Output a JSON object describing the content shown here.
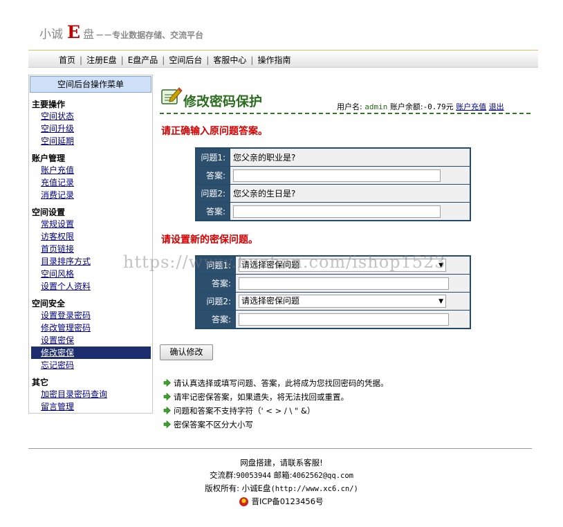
{
  "header": {
    "brand_part1": "小诚",
    "brand_e": "E",
    "brand_part2": "盘",
    "slogan": "－－专业数据存储、交流平台"
  },
  "nav": {
    "items": [
      "首页",
      "注册E盘",
      "E盘产品",
      "空间后台",
      "客服中心",
      "操作指南"
    ],
    "separator": "|"
  },
  "sidebar": {
    "title": "空间后台操作菜单",
    "groups": [
      {
        "title": "主要操作",
        "links": [
          "空间状态",
          "空间升级",
          "空间延期"
        ]
      },
      {
        "title": "账户管理",
        "links": [
          "账户充值",
          "充值记录",
          "消费记录"
        ]
      },
      {
        "title": "空间设置",
        "links": [
          "常规设置",
          "访客权限",
          "首页链接",
          "目录排序方式",
          "空间风格",
          "设置个人资料"
        ]
      },
      {
        "title": "空间安全",
        "links": [
          "设置登录密码",
          "修改管理密码",
          "设置密保",
          "修改密保",
          "忘记密码"
        ]
      },
      {
        "title": "其它",
        "links": [
          "加密目录密码查询",
          "留言管理"
        ]
      }
    ],
    "active_link": "修改密保"
  },
  "main": {
    "title": "修改密码保护",
    "user_label": "用户名:",
    "username": "admin",
    "balance_label": "账户余额:",
    "balance": "-0.79元",
    "recharge_link": "账户充值",
    "logout_link": "退出"
  },
  "old_answers": {
    "heading": "请正确输入原问题答案。",
    "q1_label": "问题1:",
    "q1_text": "您父亲的职业是?",
    "a1_label": "答案:",
    "q2_label": "问题2:",
    "q2_text": "您父亲的生日是?",
    "a2_label": "答案:"
  },
  "new_questions": {
    "heading": "请设置新的密保问题。",
    "q1_label": "问题1:",
    "q1_select": "请选择密保问题",
    "a1_label": "答案:",
    "q2_label": "问题2:",
    "q2_select": "请选择密保问题",
    "a2_label": "答案:"
  },
  "confirm_button": "确认修改",
  "tips": [
    "请认真选择或填写问题、答案，此将成为您找回密码的凭据。",
    "请牢记密保答案，如果遗失，将无法找回或重置。",
    "问题和答案不支持字符（' < > / \\ \" &）",
    "密保答案不区分大小写"
  ],
  "watermark": "https://www.huzhan.com/ishop1523",
  "footer": {
    "line1": "网盘搭建，请联系客服!",
    "qq_group_label": "交流群:",
    "qq_group": "90053944",
    "email_label": "邮箱:",
    "email": "4062562@qq.com",
    "copyright_label": "版权所有:",
    "copyright_name": "小诚E盘",
    "copyright_url": "(http://www.xc6.cn/)",
    "icp": "晋ICP备0123456号"
  },
  "colors": {
    "title_green": "#2b6d1e",
    "heading_red": "#d40000",
    "table_header": "#2c4f6e",
    "active_menu": "#1c2e6e"
  }
}
